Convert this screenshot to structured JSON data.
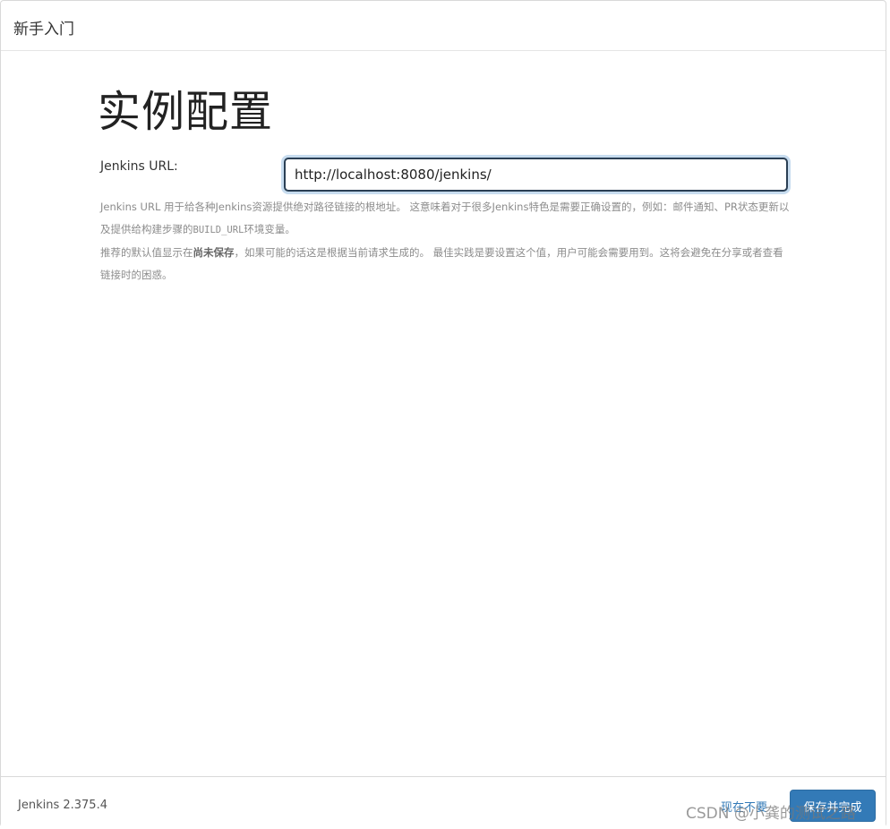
{
  "header": {
    "title": "新手入门"
  },
  "main": {
    "title": "实例配置",
    "url_label": "Jenkins URL:",
    "url_value": "http://localhost:8080/jenkins/",
    "help_line1_a": "Jenkins URL 用于给各种Jenkins资源提供绝对路径链接的根地址。 这意味着对于很多Jenkins特色是需要正确设置的，例如：邮件通知、PR状态更新以及提供给构建步骤的",
    "help_line1_code": "BUILD_URL",
    "help_line1_b": "环境变量。",
    "help_line2_a": "推荐的默认值显示在",
    "help_line2_bold": "尚未保存",
    "help_line2_b": "，如果可能的话这是根据当前请求生成的。 最佳实践是要设置这个值，用户可能会需要用到。这将会避免在分享或者查看链接时的困惑。"
  },
  "footer": {
    "version": "Jenkins 2.375.4",
    "skip_label": "现在不要",
    "save_label": "保存并完成"
  },
  "watermark": "CSDN @小龚的测试之路",
  "colors": {
    "primary": "#337ab7",
    "input_border": "#2a3f54",
    "focus_glow": "#c7dcef"
  }
}
